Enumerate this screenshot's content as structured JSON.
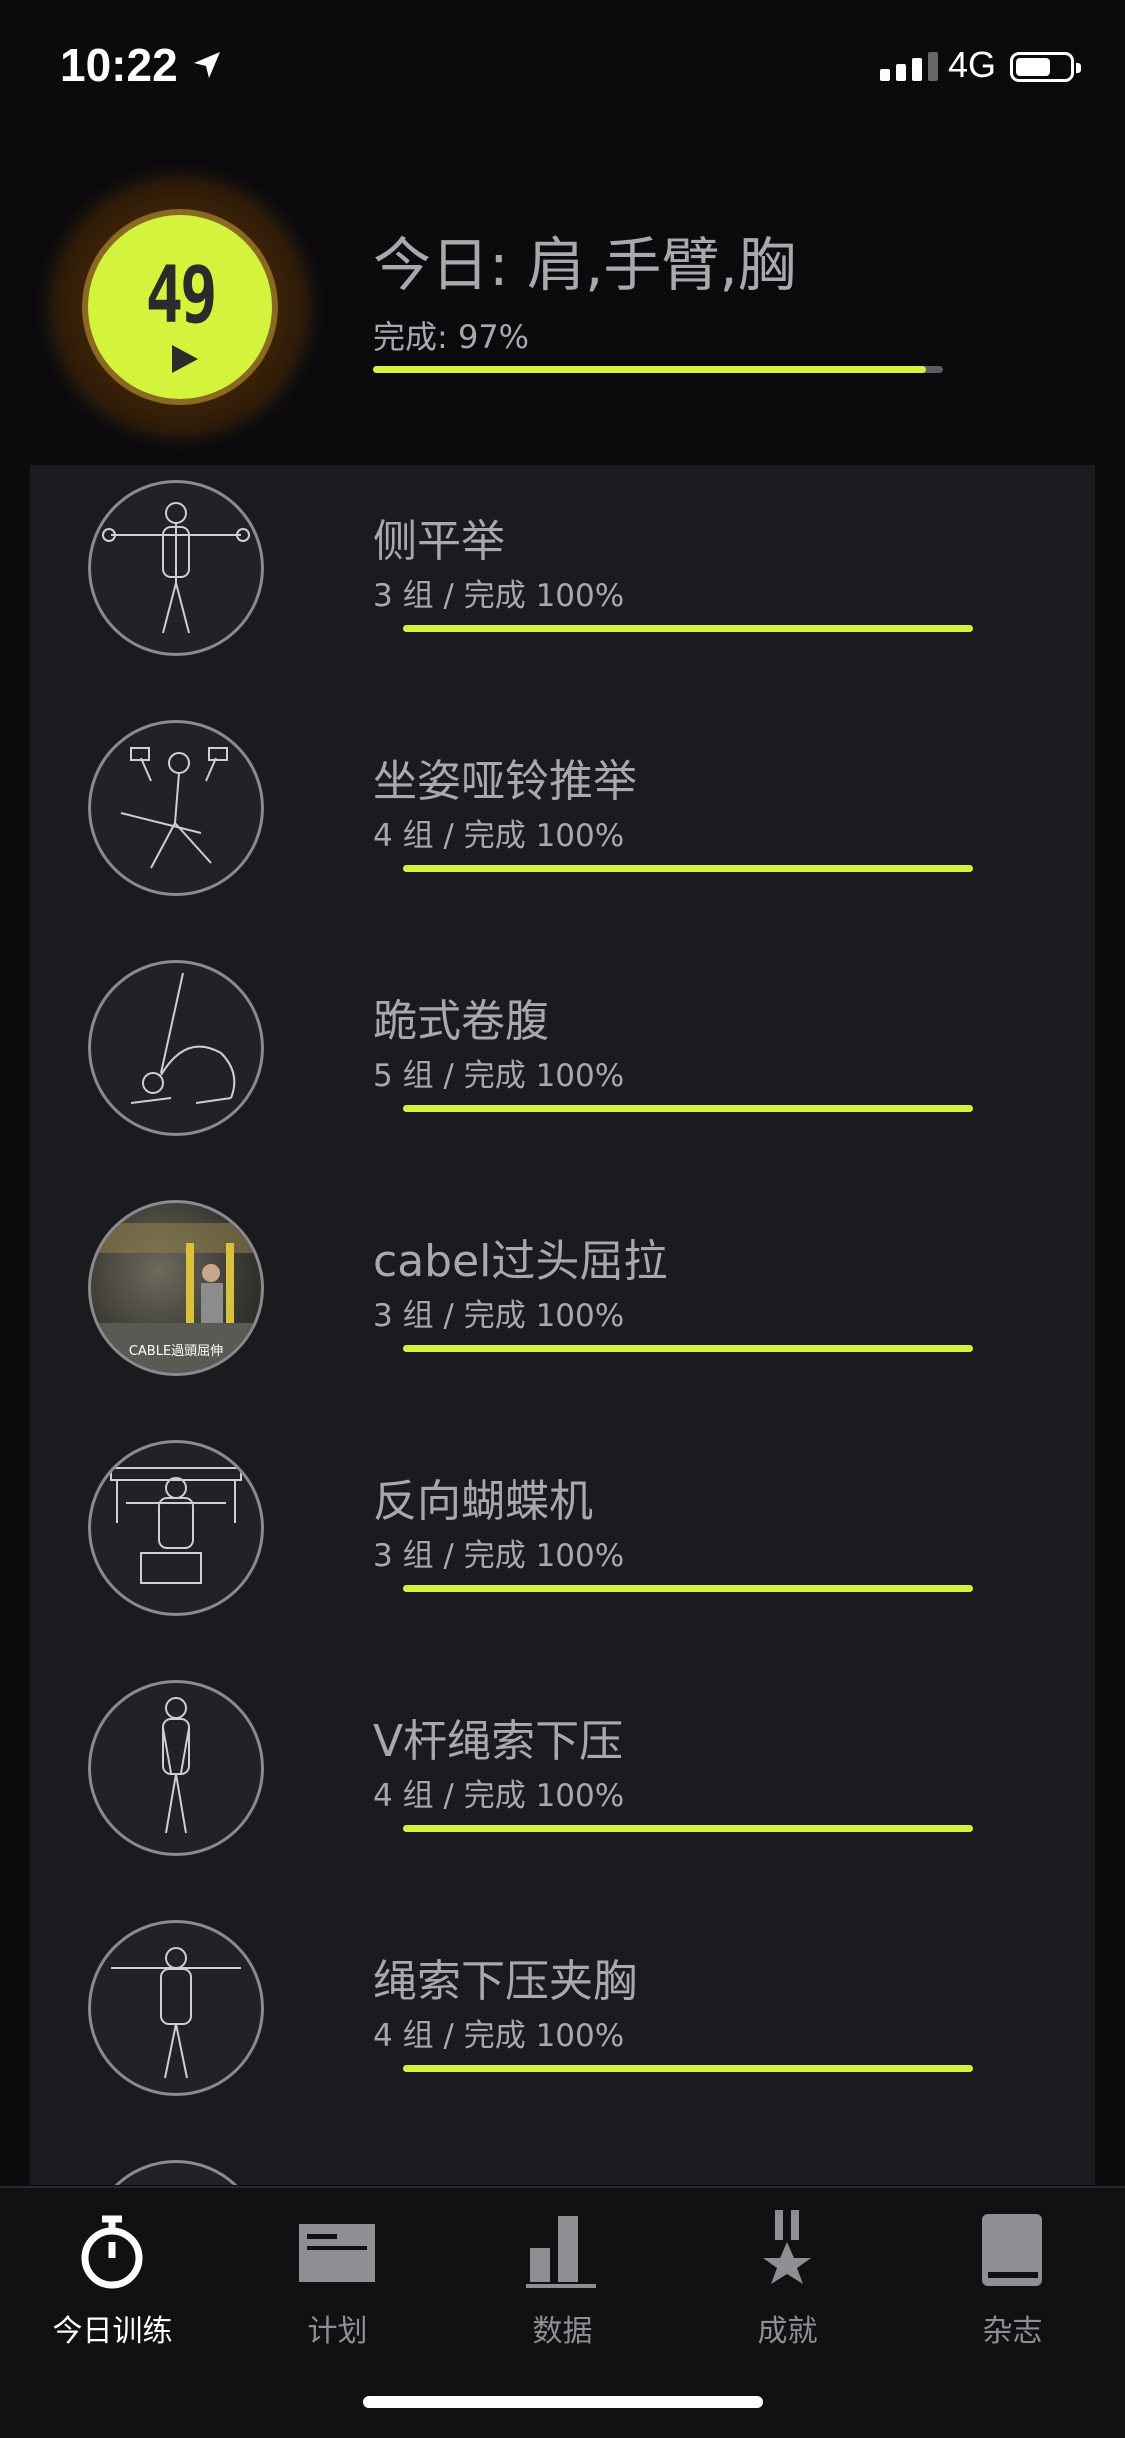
{
  "status_bar": {
    "time": "10:22",
    "network": "4G"
  },
  "summary": {
    "count": "49",
    "title": "今日: 肩,手臂,胸",
    "completion_label": "完成: 97%",
    "completion_fraction": 0.97
  },
  "exercises": [
    {
      "name": "侧平举",
      "meta": "3 组 / 完成 100%",
      "icon": "lateral-raise-figure-icon",
      "progress": 1.0
    },
    {
      "name": "坐姿哑铃推举",
      "meta": "4 组 / 完成 100%",
      "icon": "seated-dumbbell-press-figure-icon",
      "progress": 1.0
    },
    {
      "name": "跪式卷腹",
      "meta": "5 组 / 完成 100%",
      "icon": "kneeling-crunch-figure-icon",
      "progress": 1.0
    },
    {
      "name": "cabel过头屈拉",
      "meta": "3 组 / 完成 100%",
      "icon": "gym-photo",
      "photo_caption": "CABLE過頭屈伸",
      "progress": 1.0
    },
    {
      "name": "反向蝴蝶机",
      "meta": "3 组 / 完成 100%",
      "icon": "reverse-fly-machine-figure-icon",
      "progress": 1.0
    },
    {
      "name": "V杆绳索下压",
      "meta": "4 组 / 完成 100%",
      "icon": "v-bar-pushdown-figure-icon",
      "progress": 1.0
    },
    {
      "name": "绳索下压夹胸",
      "meta": "4 组 / 完成 100%",
      "icon": "cable-crossover-figure-icon",
      "progress": 1.0
    }
  ],
  "tabs": [
    {
      "label": "今日训练",
      "icon": "stopwatch-icon",
      "active": true
    },
    {
      "label": "计划",
      "icon": "plan-card-icon",
      "active": false
    },
    {
      "label": "数据",
      "icon": "bar-chart-icon",
      "active": false
    },
    {
      "label": "成就",
      "icon": "medal-icon",
      "active": false
    },
    {
      "label": "杂志",
      "icon": "book-icon",
      "active": false
    }
  ],
  "colors": {
    "accent": "#d4f33c",
    "background": "#0b0a0d",
    "list_bg": "#1b1b1f",
    "text": "#a8a8ad"
  }
}
